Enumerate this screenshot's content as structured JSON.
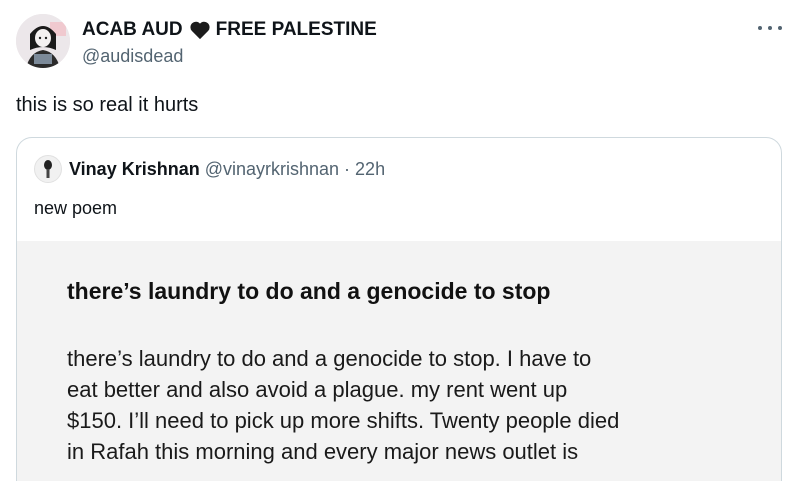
{
  "author": {
    "display_name_left": "ACAB AUD",
    "display_name_right": "FREE PALESTINE",
    "heart_icon": "black-heart-icon",
    "handle": "@audisdead"
  },
  "tweet": {
    "text": "this is so real it hurts"
  },
  "quoted": {
    "name": "Vinay Krishnan",
    "handle": "@vinayrkrishnan",
    "separator": "·",
    "time": "22h",
    "text": "new poem",
    "poem": {
      "title": "there’s laundry to do and a genocide to stop",
      "lines": [
        "there’s laundry to do and a genocide to stop. I have to",
        "eat better and also avoid a plague. my rent went up",
        "$150. I’ll need to pick up more shifts. Twenty people died",
        "in Rafah this morning and every major news outlet is"
      ]
    }
  },
  "colors": {
    "text": "#0f1419",
    "secondary": "#536471",
    "border": "#cfd9de",
    "media_bg": "#f3f3f3"
  }
}
